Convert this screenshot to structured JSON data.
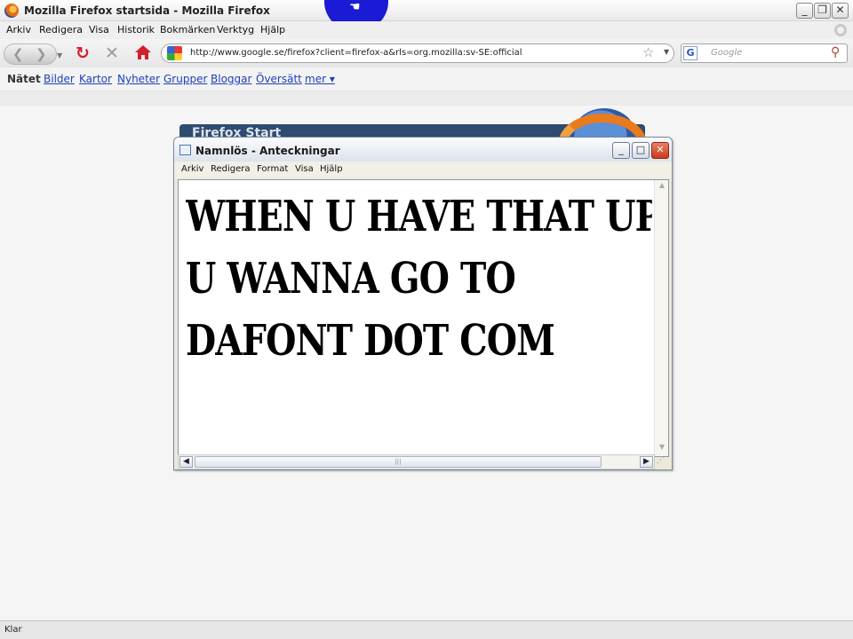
{
  "browser": {
    "window_title": "Mozilla Firefox startsida - Mozilla Firefox",
    "menu": [
      "Arkiv",
      "Redigera",
      "Visa",
      "Historik",
      "Bokmärken",
      "Verktyg",
      "Hjälp"
    ],
    "url": "http://www.google.se/firefox?client=firefox-a&rls=org.mozilla:sv-SE:official",
    "search_placeholder": "Google",
    "status": "Klar"
  },
  "google_bar": {
    "current": "Nätet",
    "links": [
      "Bilder",
      "Kartor",
      "Nyheter",
      "Grupper",
      "Bloggar",
      "Översätt",
      "mer ▾"
    ]
  },
  "start_page": {
    "banner_text": "Firefox Start"
  },
  "notepad": {
    "title": "Namnlös - Anteckningar",
    "menu": [
      "Arkiv",
      "Redigera",
      "Format",
      "Visa",
      "Hjälp"
    ],
    "lines": [
      "WHEN U HAVE THAT UP",
      "U WANNA GO TO",
      "DAFONT DOT COM"
    ]
  },
  "icons": {
    "browser_icon": "firefox-icon",
    "notepad_icon": "notepad-icon"
  },
  "colors": {
    "link": "#1f3fb8",
    "reload": "#d0202a",
    "cursor_highlight": "#1b1bd6",
    "close_button": "#c93a1f"
  }
}
